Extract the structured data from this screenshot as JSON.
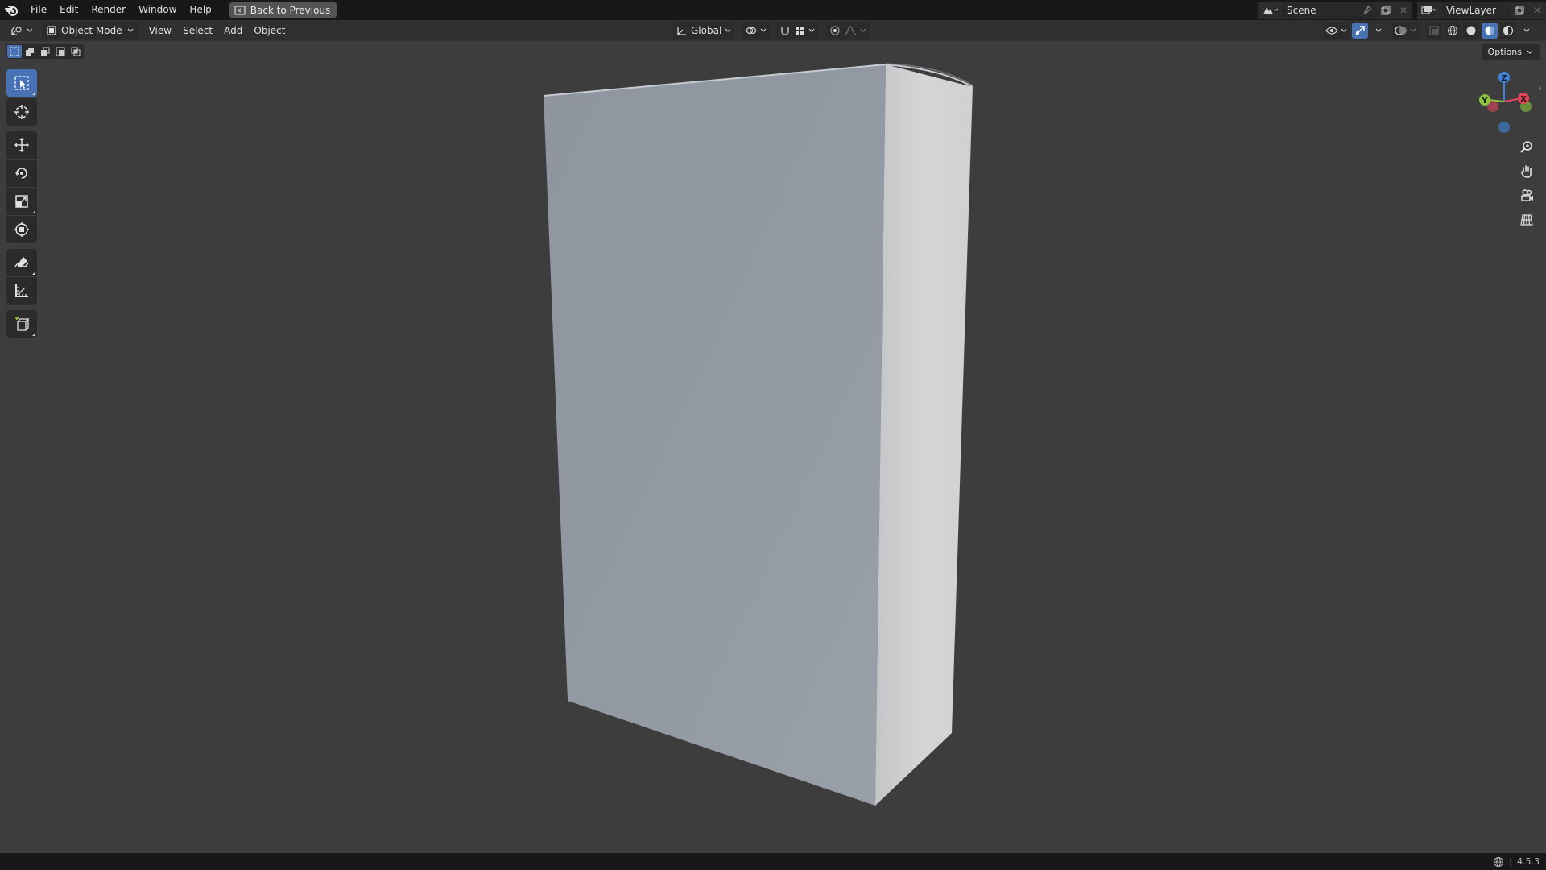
{
  "topbar": {
    "menus": [
      "File",
      "Edit",
      "Render",
      "Window",
      "Help"
    ],
    "back_button": "Back to Previous",
    "scene": "Scene",
    "view_layer": "ViewLayer"
  },
  "viewport_header": {
    "mode": "Object Mode",
    "menus": [
      "View",
      "Select",
      "Add",
      "Object"
    ],
    "transform_orientation": "Global",
    "options_label": "Options"
  },
  "toolbar": {
    "tools": [
      "select-box",
      "cursor",
      "move",
      "rotate",
      "scale",
      "transform",
      "annotate",
      "measure",
      "add-cube"
    ],
    "active_tool": "select-box"
  },
  "gizmo": {
    "axes": [
      "Z",
      "Y",
      "X"
    ],
    "colors": {
      "x": "#e0445a",
      "y": "#8cc43b",
      "z": "#3b85e0"
    }
  },
  "statusbar": {
    "version": "4.5.3"
  },
  "colors": {
    "accent": "#4772b3",
    "viewport_bg": "#3d3d3d",
    "header_bg": "#303030",
    "topbar_bg": "#181818"
  }
}
